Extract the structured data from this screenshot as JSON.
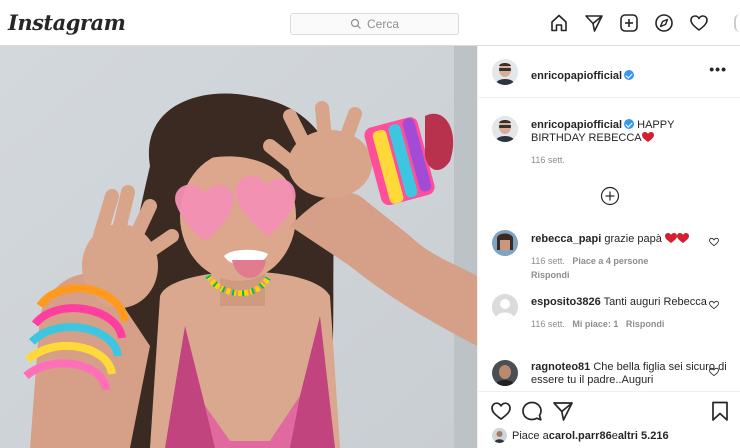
{
  "header": {
    "logo": "Instagram",
    "search_placeholder": "Cerca"
  },
  "nav_icons": [
    "home-icon",
    "direct-icon",
    "new-post-icon",
    "explore-icon",
    "activity-icon"
  ],
  "post": {
    "author": "enricopapiofficial",
    "verified": true,
    "caption": "HAPPY BIRTHDAY REBECCA",
    "caption_emoji": "red-heart",
    "caption_time": "116 sett.",
    "likes_prefix": "Piace a ",
    "likes_user": "carol.parr86",
    "likes_mid": " e ",
    "likes_others": "altri 5.216"
  },
  "comments": [
    {
      "user": "rebecca_papi",
      "text": "grazie papà",
      "emoji": "two-red-hearts",
      "time": "116 sett.",
      "likes": "Piace a 4 persone",
      "reply": "Rispondi"
    },
    {
      "user": "esposito3826",
      "text": "Tanti auguri Rebecca",
      "time": "116 sett.",
      "likes": "Mi piace: 1",
      "reply": "Rispondi"
    },
    {
      "user": "ragnoteo81",
      "text": "Che bella figlia sei sicuro di essere tu il padre..Auguri"
    }
  ],
  "colors": {
    "accent": "#3897f0",
    "heart": "#ed4956",
    "border": "#dbdbdb"
  }
}
